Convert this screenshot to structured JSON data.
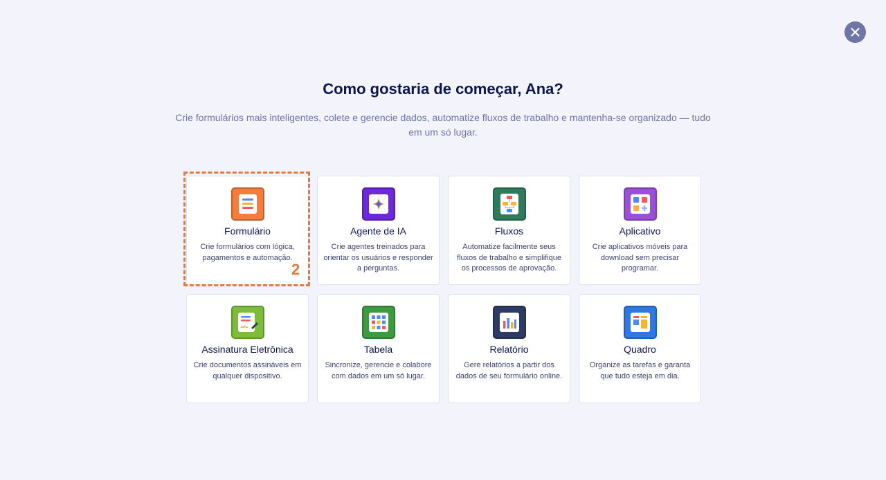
{
  "header": {
    "title": "Como gostaria de começar, Ana?",
    "subtitle": "Crie formulários mais inteligentes, colete e gerencie dados, automatize fluxos de trabalho e mantenha-se organizado — tudo em um só lugar."
  },
  "close": {
    "icon": "close-icon"
  },
  "cards": [
    {
      "title": "Formulário",
      "desc": "Crie formulários com lógica, pagamentos e automação.",
      "icon": "form-icon",
      "color": "#f47c3c"
    },
    {
      "title": "Agente de IA",
      "desc": "Crie agentes treinados para orientar os usuários e responder a perguntas.",
      "icon": "ai-sparkle-icon",
      "color": "#6c28d9"
    },
    {
      "title": "Fluxos",
      "desc": "Automatize facilmente seus fluxos de trabalho e simplifique os processos de aprovação.",
      "icon": "flow-icon",
      "color": "#2f7a5a"
    },
    {
      "title": "Aplicativo",
      "desc": "Crie aplicativos móveis para download sem precisar programar.",
      "icon": "app-grid-icon",
      "color": "#9b4ed8"
    },
    {
      "title": "Assinatura Eletrônica",
      "desc": "Crie documentos assináveis em qualquer dispositivo.",
      "icon": "signature-icon",
      "color": "#7dbb3a"
    },
    {
      "title": "Tabela",
      "desc": "Sincronize, gerencie e colabore com dados em um só lugar.",
      "icon": "table-icon",
      "color": "#3e9a3e"
    },
    {
      "title": "Relatório",
      "desc": "Gere relatórios a partir dos dados de seu formulário online.",
      "icon": "report-chart-icon",
      "color": "#2d3a63"
    },
    {
      "title": "Quadro",
      "desc": "Organize as tarefas e garanta que tudo esteja em dia.",
      "icon": "board-icon",
      "color": "#2e78e0"
    }
  ],
  "annotation": {
    "label": "2",
    "color": "#e8773d"
  }
}
